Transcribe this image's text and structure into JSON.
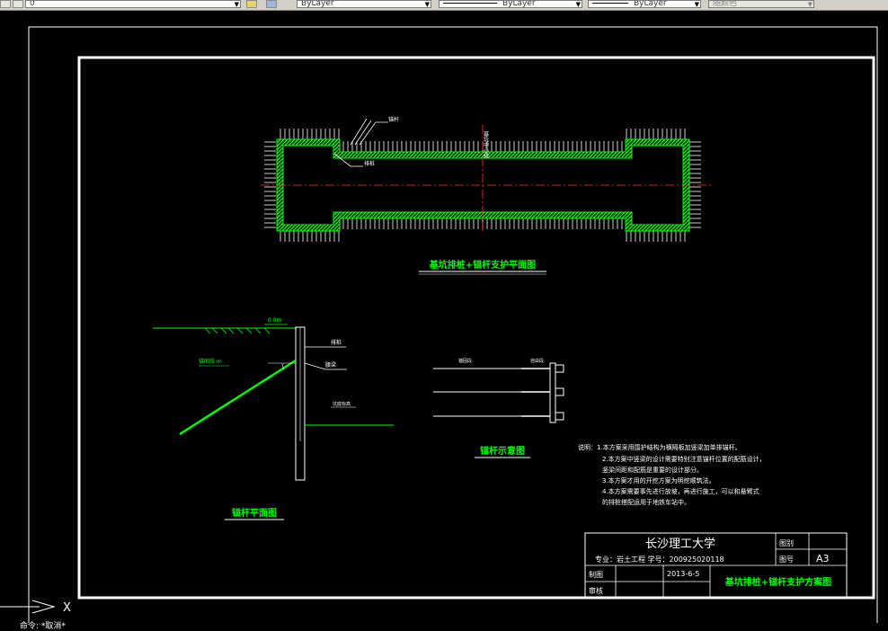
{
  "toolbar": {
    "layer_value": "0",
    "color_value": "ByLayer",
    "linetype_value": "ByLayer",
    "lineweight_value": "ByLayer",
    "plotstyle_value": "随颜色"
  },
  "drawing": {
    "plan_title": "基坑排桩+锚杆支护平面图",
    "plan_label_anchor": "锚杆",
    "plan_label_pile": "排桩",
    "plan_label_center": "基坑中心线",
    "section_title": "锚杆平面图",
    "section_label_level": "0.0m",
    "section_label_pile": "排桩",
    "section_label_waist": "腰梁",
    "section_label_depth": "锚固段  m",
    "section_label_bottom": "坑底标高",
    "anchor_title": "锚杆示意图",
    "anchor_label_free": "自由段",
    "anchor_label_fixed": "锚固段",
    "notes": [
      "说明：1.本方案采用围护结构为横隔板加竖梁加单排锚杆。",
      "2.本方案中竖梁的设计需要特别注意锚杆位置的配筋设计，",
      "竖梁间距和配筋是重要的设计部分。",
      "3.本方案才用的开挖方案为明挖顺筑法。",
      "4.本方案需要事先进行放坡，再进行施工，可以和悬臂式",
      "的排桩搭配运用于地铁车站中。"
    ]
  },
  "titleblock": {
    "school": "长沙理工大学",
    "major_line": "专业：岩土工程  学号：200925020118",
    "drawing_cat_label": "图别",
    "drawing_no_label": "图号",
    "sheet_size": "A3",
    "drafter_label": "制图",
    "reviewer_label": "审核",
    "date": "2013-6-5",
    "project_title": "基坑排桩+锚杆支护方案图"
  },
  "ucs": {
    "x_label": "X"
  },
  "command_line": "命令: *取消*"
}
